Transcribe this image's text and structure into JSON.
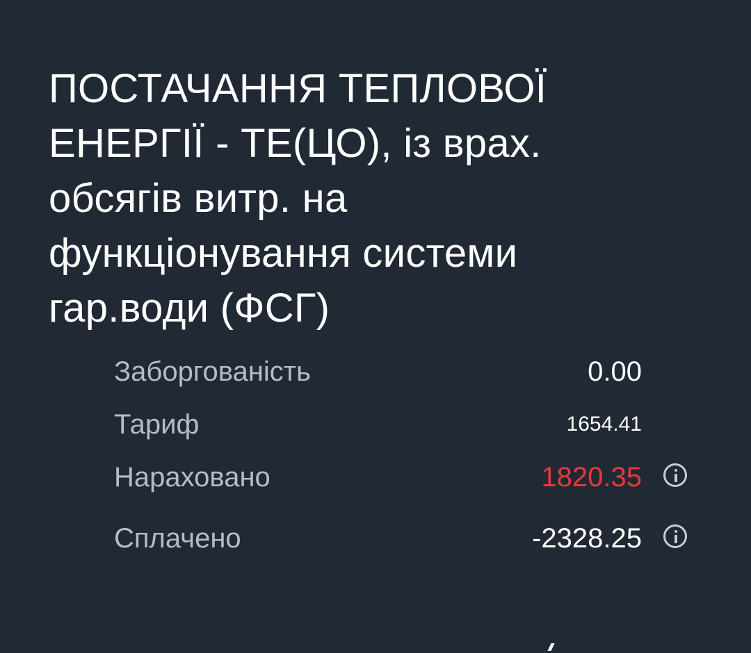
{
  "service": {
    "title": "ПОСТАЧАННЯ ТЕПЛОВОЇ\nЕНЕРГІЇ - ТЕ(ЦО), із врах.\nобсягів витр. на\nфункціонування системи\nгар.води (ФСГ)"
  },
  "details": {
    "debt": {
      "label": "Заборгованість",
      "value": "0.00"
    },
    "tariff": {
      "label": "Тариф",
      "value": "1654.41"
    },
    "charged": {
      "label": "Нараховано",
      "value": "1820.35",
      "icon": "info-icon"
    },
    "paid": {
      "label": "Сплачено",
      "value": "-2328.25",
      "icon": "info-icon"
    }
  },
  "colors": {
    "background": "#212934",
    "label": "#b5bcc6",
    "value": "#ffffff",
    "charged_value": "#e8383b"
  }
}
